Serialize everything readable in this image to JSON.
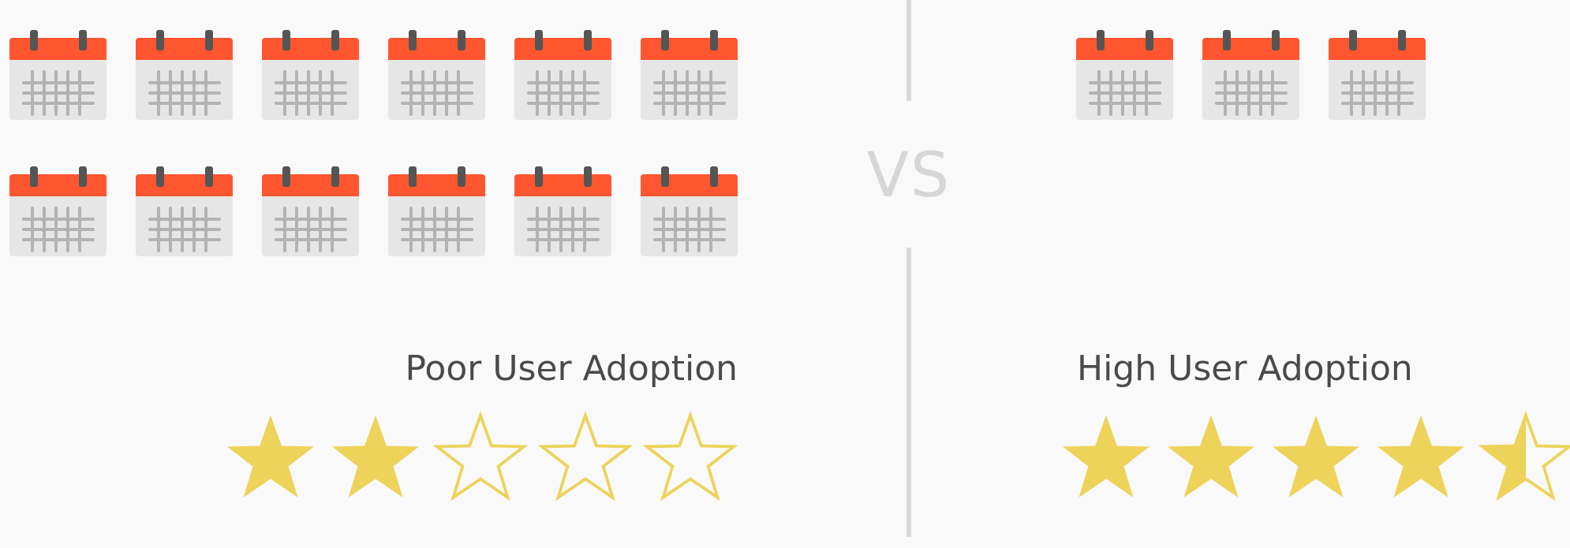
{
  "colors": {
    "calendar_header": "#ff5630",
    "calendar_body": "#e6e6e6",
    "calendar_rings": "#555555",
    "calendar_grid": "#b3b3b3",
    "star": "#edd35a",
    "divider": "#d9d9d9",
    "caption": "#4a4a4a"
  },
  "left": {
    "calendar_count": 12,
    "caption": "Poor User Adoption",
    "rating": {
      "value": 2,
      "max": 5
    }
  },
  "divider": {
    "label": "VS"
  },
  "right": {
    "calendar_count": 3,
    "caption": "High User Adoption",
    "rating": {
      "value": 4.5,
      "max": 5
    }
  }
}
